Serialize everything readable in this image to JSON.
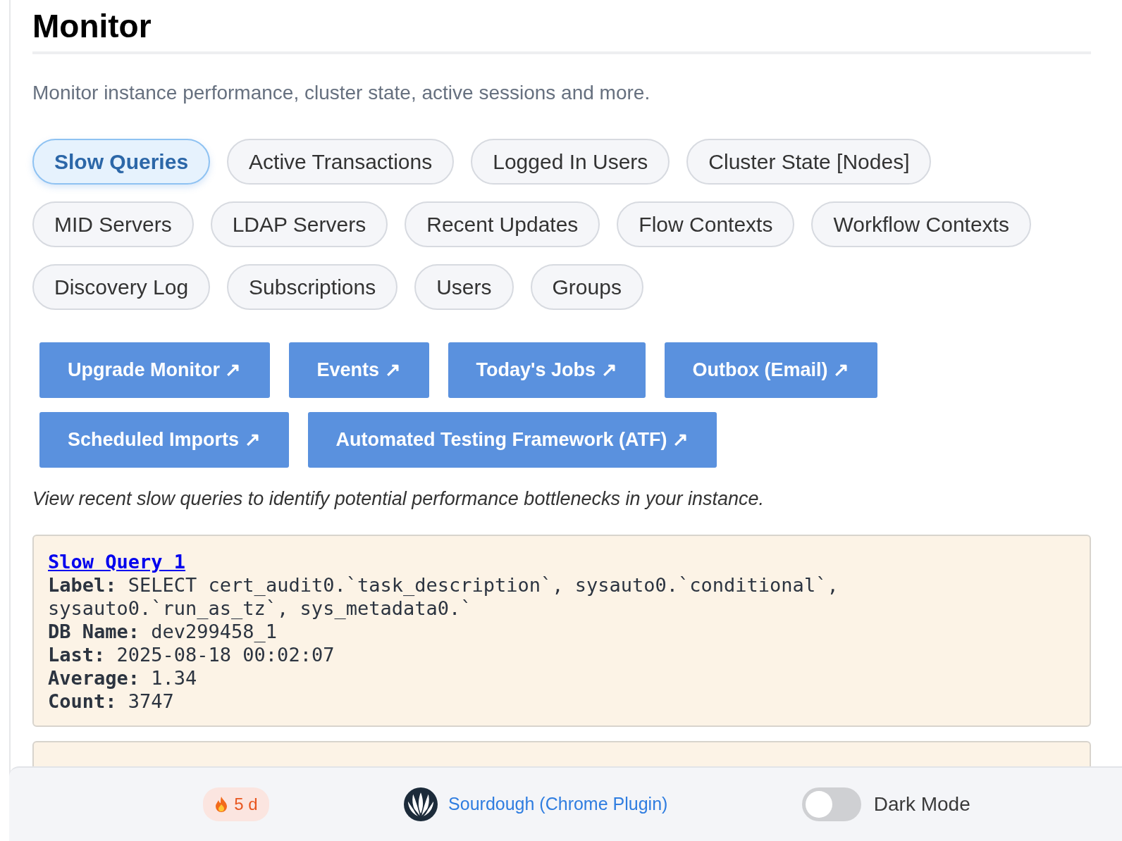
{
  "title": "Monitor",
  "subtitle": "Monitor instance performance, cluster state, active sessions and more.",
  "tabs": [
    {
      "label": "Slow Queries",
      "selected": true
    },
    {
      "label": "Active Transactions",
      "selected": false
    },
    {
      "label": "Logged In Users",
      "selected": false
    },
    {
      "label": "Cluster State [Nodes]",
      "selected": false
    },
    {
      "label": "MID Servers",
      "selected": false
    },
    {
      "label": "LDAP Servers",
      "selected": false
    },
    {
      "label": "Recent Updates",
      "selected": false
    },
    {
      "label": "Flow Contexts",
      "selected": false
    },
    {
      "label": "Workflow Contexts",
      "selected": false
    },
    {
      "label": "Discovery Log",
      "selected": false
    },
    {
      "label": "Subscriptions",
      "selected": false
    },
    {
      "label": "Users",
      "selected": false
    },
    {
      "label": "Groups",
      "selected": false
    }
  ],
  "link_buttons": [
    {
      "label": "Upgrade Monitor ↗"
    },
    {
      "label": "Events ↗"
    },
    {
      "label": "Today's Jobs ↗"
    },
    {
      "label": "Outbox (Email) ↗"
    },
    {
      "label": "Scheduled Imports ↗"
    },
    {
      "label": "Automated Testing Framework (ATF) ↗"
    }
  ],
  "description": "View recent slow queries to identify potential performance bottlenecks in your instance.",
  "queries": [
    {
      "title": "Slow Query 1",
      "fields": [
        {
          "label": "Label:",
          "value": "SELECT cert_audit0.`task_description`, sysauto0.`conditional`,",
          "wrapped_value": "sysauto0.`run_as_tz`, sys_metadata0.`"
        },
        {
          "label": "DB Name:",
          "value": "dev299458_1"
        },
        {
          "label": "Last:",
          "value": "2025-08-18 00:02:07"
        },
        {
          "label": "Average:",
          "value": "1.34"
        },
        {
          "label": "Count:",
          "value": "3747"
        }
      ]
    }
  ],
  "footer": {
    "streak": "5 d",
    "plugin_link": "Sourdough (Chrome Plugin)",
    "dark_mode": {
      "label": "Dark Mode",
      "on": false
    }
  }
}
